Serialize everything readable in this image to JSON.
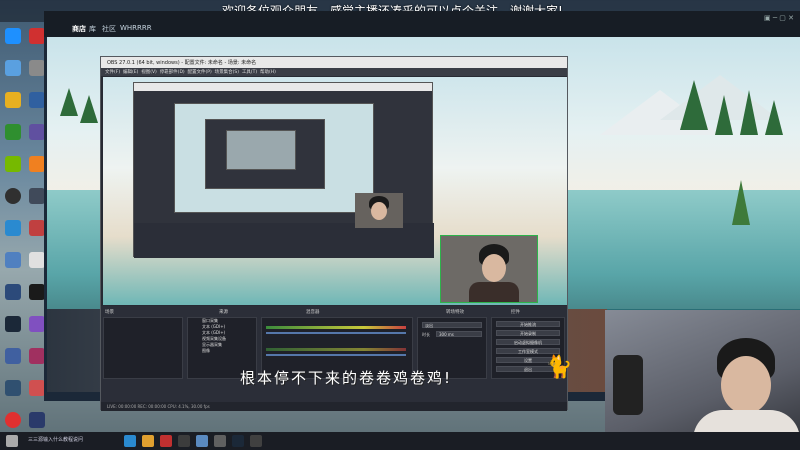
{
  "banner": {
    "text": "欢迎各位观众朋友，感觉主播还凑乎的可以点个关注，谢谢大家!"
  },
  "steam": {
    "nav": [
      "商店",
      "库",
      "社区",
      "WHRRRR"
    ]
  },
  "obs": {
    "title": "OBS 27.0.1 (64 bit, windows) - 配置文件: 未命名 - 场景: 未命名",
    "menu": [
      "文件(F)",
      "编辑(E)",
      "视图(V)",
      "停靠部件(D)",
      "配置文件(P)",
      "场景集合(S)",
      "工具(T)",
      "帮助(H)"
    ],
    "docks": {
      "scenes": "场景",
      "sources": "来源",
      "mixer": "混音器",
      "transitions": "转场特效",
      "controls": "控件"
    },
    "sources": [
      "窗口采集",
      "文本 (GDI+)",
      "文本 (GDI+)",
      "视频采集设备",
      "显示器采集",
      "图像"
    ],
    "controls": [
      "开始推流",
      "开始录制",
      "启动虚拟摄像机",
      "工作室模式",
      "设置",
      "退出"
    ],
    "transition_value": "淡出",
    "duration_label": "时长",
    "duration_value": "300 ms",
    "status": "LIVE: 00:00:00   REC: 00:00:00   CPU: 4.1%, 30.00 fps"
  },
  "subtitle": {
    "text": "根本停不下来的卷卷鸡卷鸡!"
  },
  "taskbar": {
    "label": "三三源输入什么教程说问"
  }
}
